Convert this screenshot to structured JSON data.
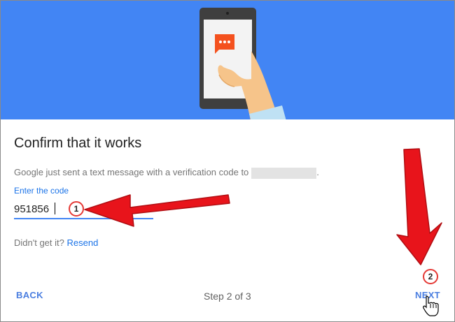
{
  "dialog": {
    "title": "Confirm that it works",
    "description": "Google just sent a text message with a verification code to",
    "description_end": ".",
    "code_label": "Enter the code",
    "code_value": "951856",
    "didnt_get": "Didn't get it?",
    "resend_label": "Resend",
    "back_label": "BACK",
    "step_label": "Step 2 of 3",
    "next_label": "NEXT"
  },
  "annotations": {
    "marker_1": "1",
    "marker_2": "2"
  },
  "colors": {
    "hero_bg": "#4285f4",
    "accent": "#1a73e8",
    "arrow": "#e8141b",
    "chat_bubble": "#f4511e"
  },
  "icons": {
    "hero": "phone-in-hand-illustration",
    "chat": "chat-bubble-icon",
    "cursor": "hand-pointer-cursor-icon",
    "arrow": "red-arrow-icon"
  }
}
